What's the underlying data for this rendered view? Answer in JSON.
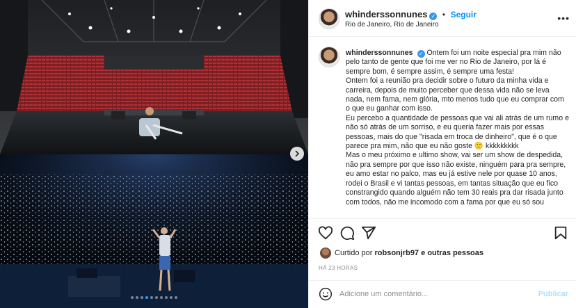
{
  "colors": {
    "accent": "#0095f6",
    "verified": "#3897f0",
    "text": "#262626",
    "muted": "#8e8e8e",
    "publish_disabled": "#b2dffc"
  },
  "carousel": {
    "total": 10,
    "active_index": 3
  },
  "post": {
    "author": "whinderssonnunes",
    "follow_label": "Seguir",
    "location": "Rio de Janeiro, Rio de Janeiro"
  },
  "caption": {
    "username": "whinderssonnunes",
    "paragraphs": [
      "Ontem foi um noite especial pra mim não pelo tanto de gente que foi me ver no Rio de Janeiro, por lá é sempre bom, é sempre assim, é sempre uma festa!",
      "Ontem foi a reunião pra decidir sobre o futuro da minha vida e carreira, depois de muito perceber que dessa vida não se leva nada, nem fama, nem glória, mto menos tudo que eu comprar com o que eu ganhar com isso.",
      "Eu percebo a quantidade de pessoas que vai ali atrás de um rumo e não só atrás de um sorriso, e eu queria fazer mais por essas pessoas, mais do que \"risada em troca de dinheiro\", que é o que parece pra mim, não que eu não goste 🙁 kkkkkkkkk",
      "Mas o meu próximo e ultimo show, vai ser um show de despedida, não pra sempre por que isso não existe, ninguém para pra sempre, eu amo estar no palco, mas eu já estive nele por quase 10 anos, rodei o Brasil e vi tantas pessoas, em tantas situação que eu fico constrangido quando alguém não tem 30 reais pra dar risada junto com todos, não me incomodo com a fama por que eu só sou"
    ]
  },
  "likes": {
    "prefix": "Curtido por",
    "user": "robsonjrb97",
    "connector": "e",
    "others": "outras pessoas"
  },
  "timestamp": "HÁ 23 HORAS",
  "comment": {
    "placeholder": "Adicione um comentário...",
    "publish_label": "Publicar"
  },
  "icons": {
    "verified": "verified-badge-icon",
    "more": "more-options-icon",
    "like": "heart-icon",
    "comment": "comment-icon",
    "share": "paper-plane-icon",
    "save": "bookmark-icon",
    "emoji": "smiley-icon",
    "next": "chevron-right-icon"
  }
}
